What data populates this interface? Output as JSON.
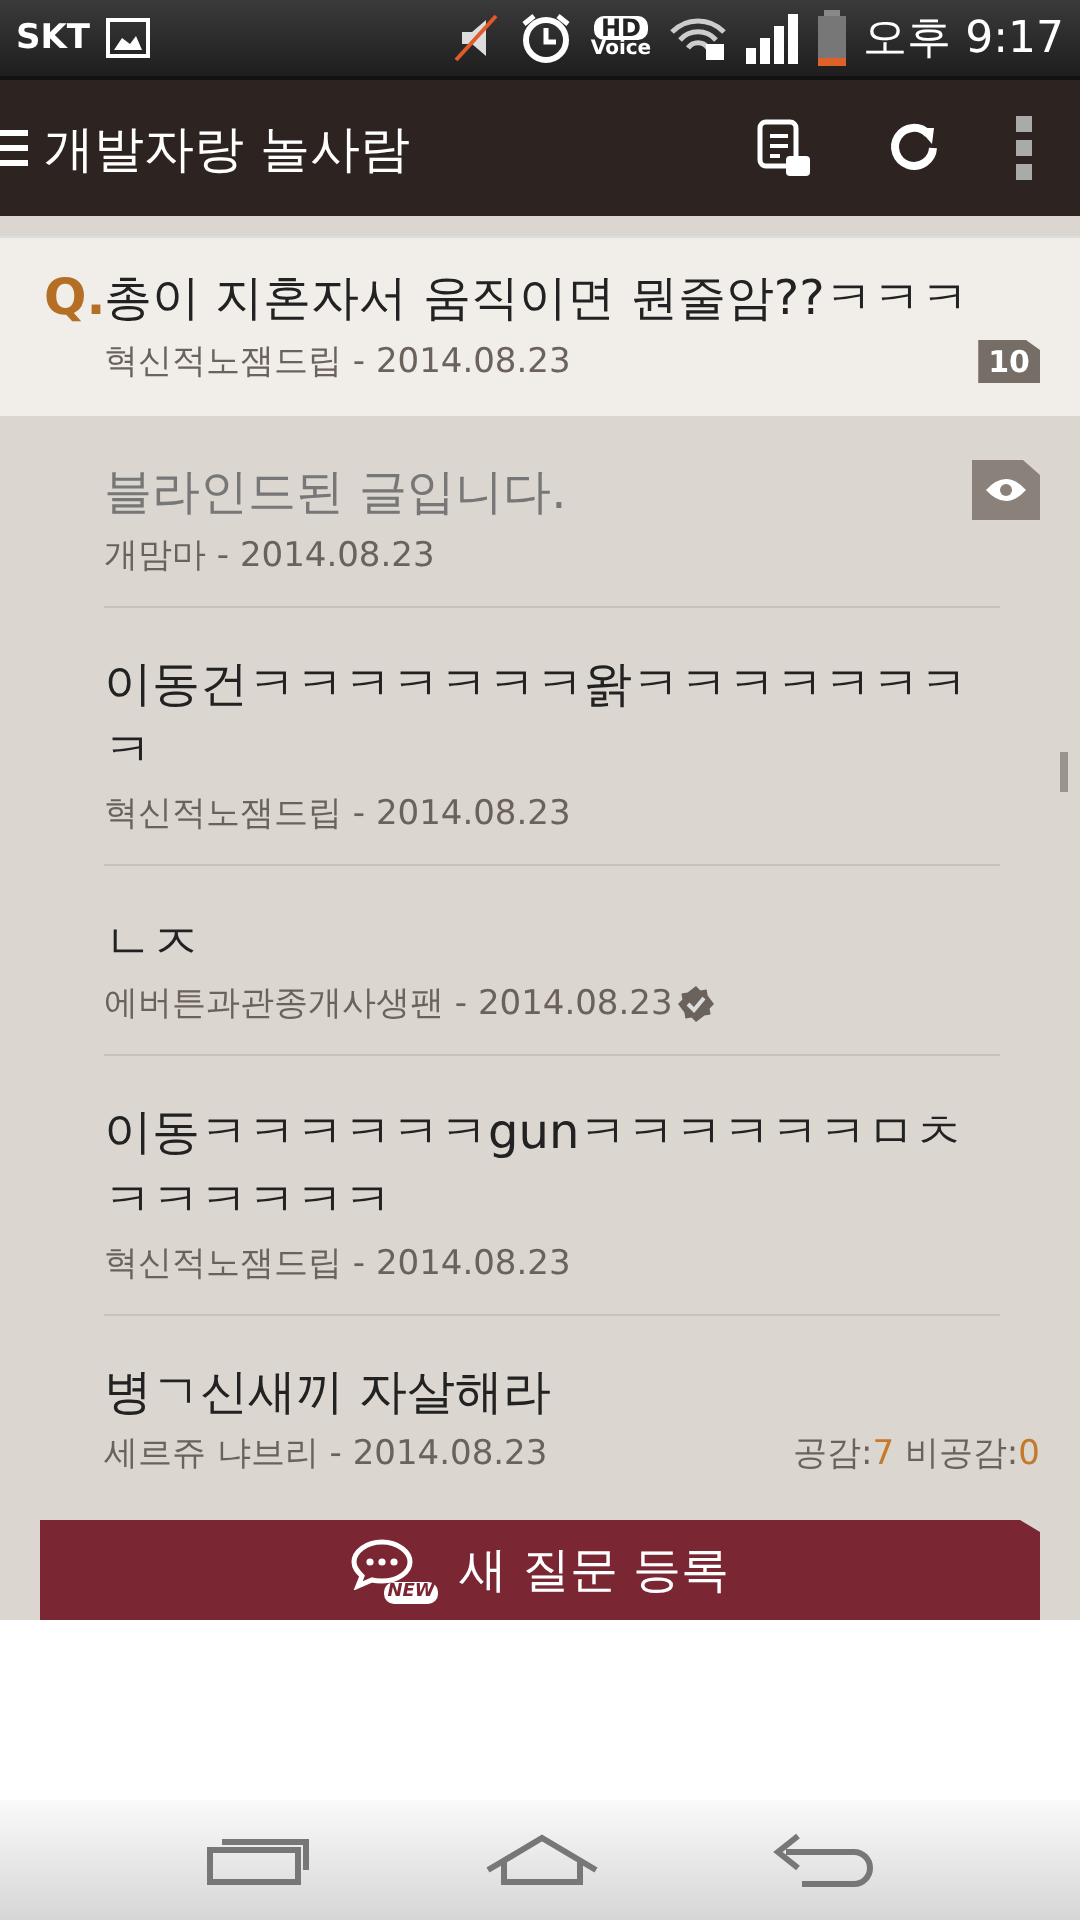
{
  "status_bar": {
    "carrier": "SKT",
    "hd": "HD",
    "voice": "Voice",
    "time": "오후 9:17"
  },
  "app_bar": {
    "title": "개발자랑 놀사람"
  },
  "question": {
    "marker": "Q.",
    "title": "총이 지혼자서 움직이면 뭔줄암??ㅋㅋㅋ",
    "byline": "혁신적노잼드립 - 2014.08.23",
    "comment_count": "10"
  },
  "answers": [
    {
      "kind": "blinded",
      "title": "블라인드된 글입니다.",
      "byline": "개맘마 - 2014.08.23",
      "verified": false
    },
    {
      "kind": "post",
      "title": "이동건ㅋㅋㅋㅋㅋㅋㅋ왉ㅋㅋㅋㅋㅋㅋㅋㅋ",
      "byline": "혁신적노잼드립 - 2014.08.23",
      "verified": false
    },
    {
      "kind": "post",
      "title": "ㄴㅈ",
      "byline": "에버튼과관종개사생팬 - 2014.08.23",
      "verified": true
    },
    {
      "kind": "post",
      "title": "이동ㅋㅋㅋㅋㅋㅋgunㅋㅋㅋㅋㅋㅋㅁㅊㅋㅋㅋㅋㅋㅋ",
      "byline": "혁신적노잼드립 - 2014.08.23",
      "verified": false
    },
    {
      "kind": "post",
      "title": "병ㄱ신새끼 자살해라",
      "byline": "세르쥬 냐브리 - 2014.08.23",
      "verified": false,
      "votes": {
        "like_label": "공감:",
        "like_count": "7",
        "dislike_label": "비공감:",
        "dislike_count": "0"
      }
    }
  ],
  "new_question_button": {
    "badge": "NEW",
    "label": "새 질문 등록"
  }
}
